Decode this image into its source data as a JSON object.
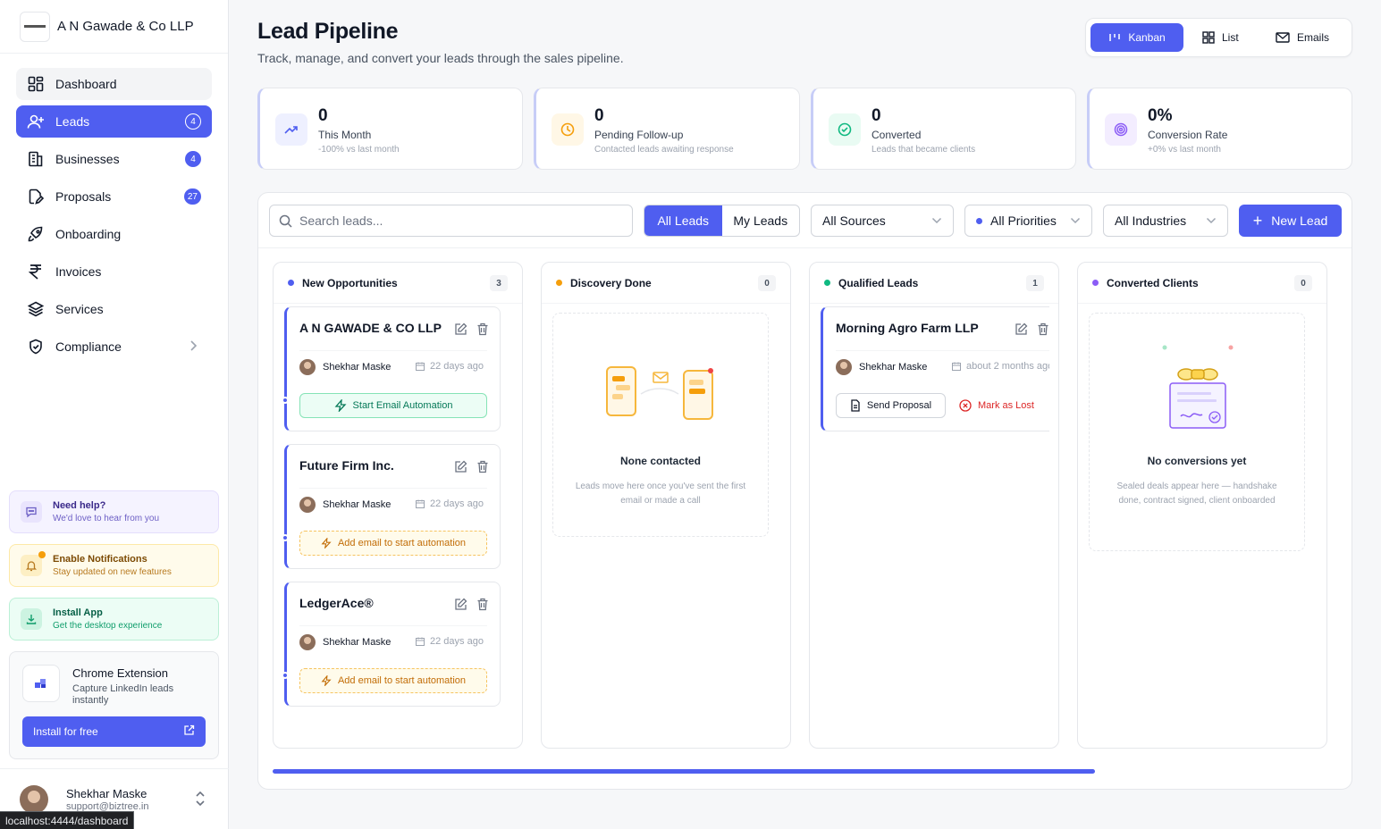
{
  "brand": {
    "name": "A N Gawade & Co LLP"
  },
  "nav": [
    {
      "label": "Dashboard",
      "icon": "dashboard-icon",
      "state": "hover"
    },
    {
      "label": "Leads",
      "icon": "user-plus-icon",
      "badge": "4",
      "state": "active"
    },
    {
      "label": "Businesses",
      "icon": "building-icon",
      "badge": "4"
    },
    {
      "label": "Proposals",
      "icon": "document-edit-icon",
      "badge": "27"
    },
    {
      "label": "Onboarding",
      "icon": "rocket-icon"
    },
    {
      "label": "Invoices",
      "icon": "rupee-icon"
    },
    {
      "label": "Services",
      "icon": "layers-icon"
    },
    {
      "label": "Compliance",
      "icon": "shield-check-icon",
      "chevron": true
    }
  ],
  "promos": {
    "help": {
      "title": "Need help?",
      "sub": "We'd love to hear from you"
    },
    "notifications": {
      "title": "Enable Notifications",
      "sub": "Stay updated on new features"
    },
    "install": {
      "title": "Install App",
      "sub": "Get the desktop experience"
    }
  },
  "extension": {
    "title": "Chrome Extension",
    "sub": "Capture LinkedIn leads instantly",
    "button": "Install for free"
  },
  "user": {
    "name": "Shekhar Maske",
    "email": "support@biztree.in"
  },
  "status_url": "localhost:4444/dashboard",
  "header": {
    "title": "Lead Pipeline",
    "subtitle": "Track, manage, and convert your leads through the sales pipeline."
  },
  "views": {
    "kanban": "Kanban",
    "list": "List",
    "emails": "Emails",
    "active": "kanban"
  },
  "stats": [
    {
      "value": "0",
      "label": "This Month",
      "sub": "-100% vs last month",
      "icon": "trend-up-icon",
      "color": "#4f5ef0",
      "bg": "#eef0ff"
    },
    {
      "value": "0",
      "label": "Pending Follow-up",
      "sub": "Contacted leads awaiting response",
      "icon": "clock-icon",
      "color": "#f59e0b",
      "bg": "#fff7e6"
    },
    {
      "value": "0",
      "label": "Converted",
      "sub": "Leads that became clients",
      "icon": "check-circle-icon",
      "color": "#10b981",
      "bg": "#e9fbf3"
    },
    {
      "value": "0%",
      "label": "Conversion Rate",
      "sub": "+0% vs last month",
      "icon": "target-icon",
      "color": "#8b5cf6",
      "bg": "#f3edff"
    }
  ],
  "toolbar": {
    "search_placeholder": "Search leads...",
    "all_leads": "All Leads",
    "my_leads": "My Leads",
    "sources": "All Sources",
    "priorities": "All Priorities",
    "industries": "All Industries",
    "new_lead": "New Lead"
  },
  "columns": [
    {
      "title": "New Opportunities",
      "count": "3",
      "color": "#4f5ef0",
      "cards": [
        {
          "name": "A N GAWADE & CO LLP",
          "owner": "Shekhar Maske",
          "date": "22 days ago",
          "action": "Start Email Automation",
          "action_type": "green"
        },
        {
          "name": "Future Firm Inc.",
          "owner": "Shekhar Maske",
          "date": "22 days ago",
          "action": "Add email to start automation",
          "action_type": "amber"
        },
        {
          "name": "LedgerAce®",
          "owner": "Shekhar Maske",
          "date": "22 days ago",
          "action": "Add email to start automation",
          "action_type": "amber"
        }
      ]
    },
    {
      "title": "Discovery Done",
      "count": "0",
      "color": "#f59e0b",
      "empty_title": "None contacted",
      "empty_sub": "Leads move here once you've sent the first email or made a call"
    },
    {
      "title": "Qualified Leads",
      "count": "1",
      "color": "#10b981",
      "cards": [
        {
          "name": "Morning Agro Farm LLP",
          "owner": "Shekhar Maske",
          "date": "about 2 months ago",
          "send": "Send Proposal",
          "lost": "Mark as Lost"
        }
      ]
    },
    {
      "title": "Converted Clients",
      "count": "0",
      "color": "#8b5cf6",
      "empty_title": "No conversions yet",
      "empty_sub": "Sealed deals appear here — handshake done, contract signed, client onboarded"
    }
  ]
}
